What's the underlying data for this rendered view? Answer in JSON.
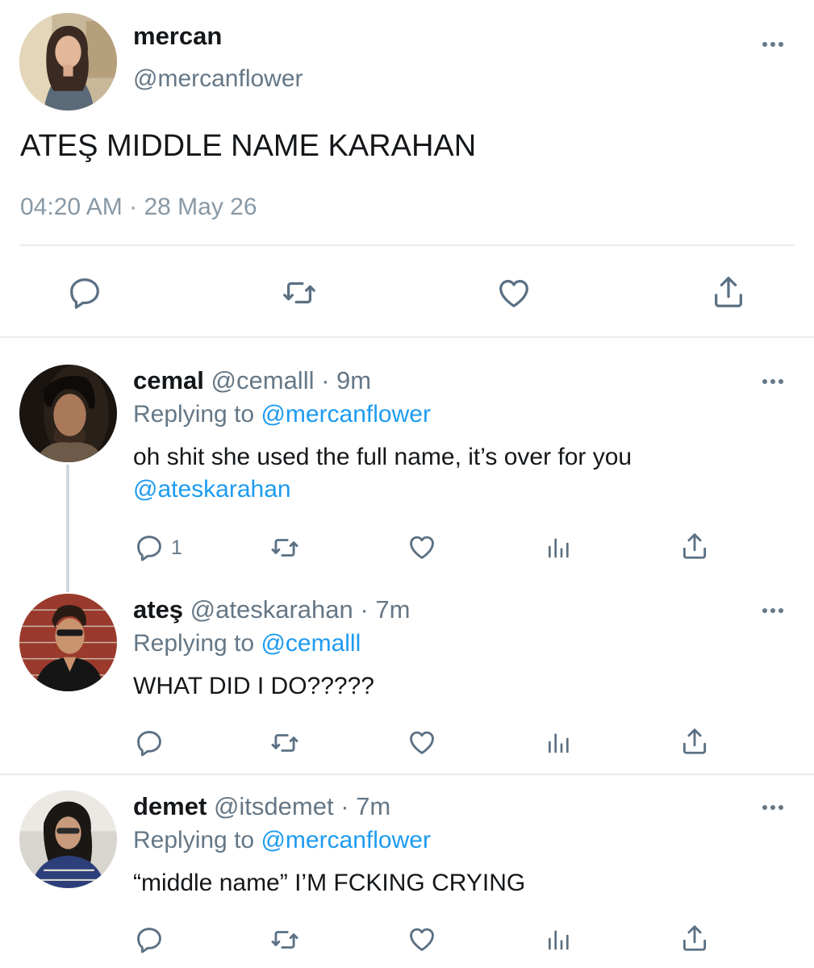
{
  "main_tweet": {
    "name": "mercan",
    "handle": "@mercanflower",
    "text": "ATEŞ MIDDLE NAME KARAHAN",
    "time": "04:20 AM",
    "separator": "·",
    "date": "28 May 26",
    "actions": [
      "reply-icon",
      "retweet-icon",
      "like-icon",
      "share-icon"
    ]
  },
  "replies": [
    {
      "name": "cemal",
      "handle": "@cemalll",
      "dot": "·",
      "time": "9m",
      "replying_label": "Replying to",
      "replying_to": "@mercanflower",
      "text": "oh shit she used the full name, it’s over for you",
      "mention": "@ateskarahan",
      "reply_count": "1"
    },
    {
      "name": "ateş",
      "handle": "@ateskarahan",
      "dot": "·",
      "time": "7m",
      "replying_label": "Replying to",
      "replying_to": "@cemalll",
      "text": "WHAT DID I DO?????"
    },
    {
      "name": "demet",
      "handle": "@itsdemet",
      "dot": "·",
      "time": "7m",
      "replying_label": "Replying to",
      "replying_to": "@mercanflower",
      "text": "“middle name” I’M FCKING CRYING"
    }
  ],
  "colors": {
    "link": "#1d9bf0",
    "secondary_text": "#657786",
    "icon": "#5b7083",
    "divider": "#e6ecf0"
  }
}
